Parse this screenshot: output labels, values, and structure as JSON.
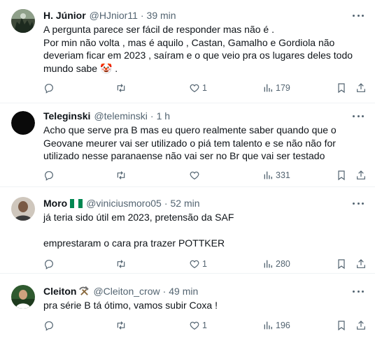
{
  "tweets": [
    {
      "name": "H. Júnior",
      "handle": "@HJnior11",
      "dot": "·",
      "time": "39 min",
      "lines": [
        "A pergunta parece ser fácil de responder mas não é .",
        "Por min não volta , mas é aquilo , Castan, Gamalho e Gordiola não deveriam ficar em 2023 , saíram e o que veio pra os lugares deles todo mundo sabe 🤡 ."
      ],
      "likes": "1",
      "views": "179"
    },
    {
      "name": "Teleginski",
      "handle": "@teleminski",
      "dot": "·",
      "time": "1 h",
      "lines": [
        "Acho que serve pra B mas eu quero realmente saber quando que o Geovane meurer vai ser utilizado o piá tem talento e se não não for utilizado nesse paranaense não vai ser no Br que vai ser testado"
      ],
      "likes": "",
      "views": "331"
    },
    {
      "name": "Moro",
      "handle": "@viniciusmoro05",
      "dot": "·",
      "time": "52 min",
      "lines": [
        "já teria sido útil em 2023, pretensão da SAF",
        "",
        "emprestaram o cara pra trazer POTTKER"
      ],
      "likes": "1",
      "views": "280"
    },
    {
      "name": "Cleiton",
      "handle": "@Cleiton_crow",
      "dot": "·",
      "time": "49 min",
      "lines": [
        "pra série B tá ótimo, vamos subir Coxa !"
      ],
      "likes": "1",
      "views": "196"
    }
  ]
}
